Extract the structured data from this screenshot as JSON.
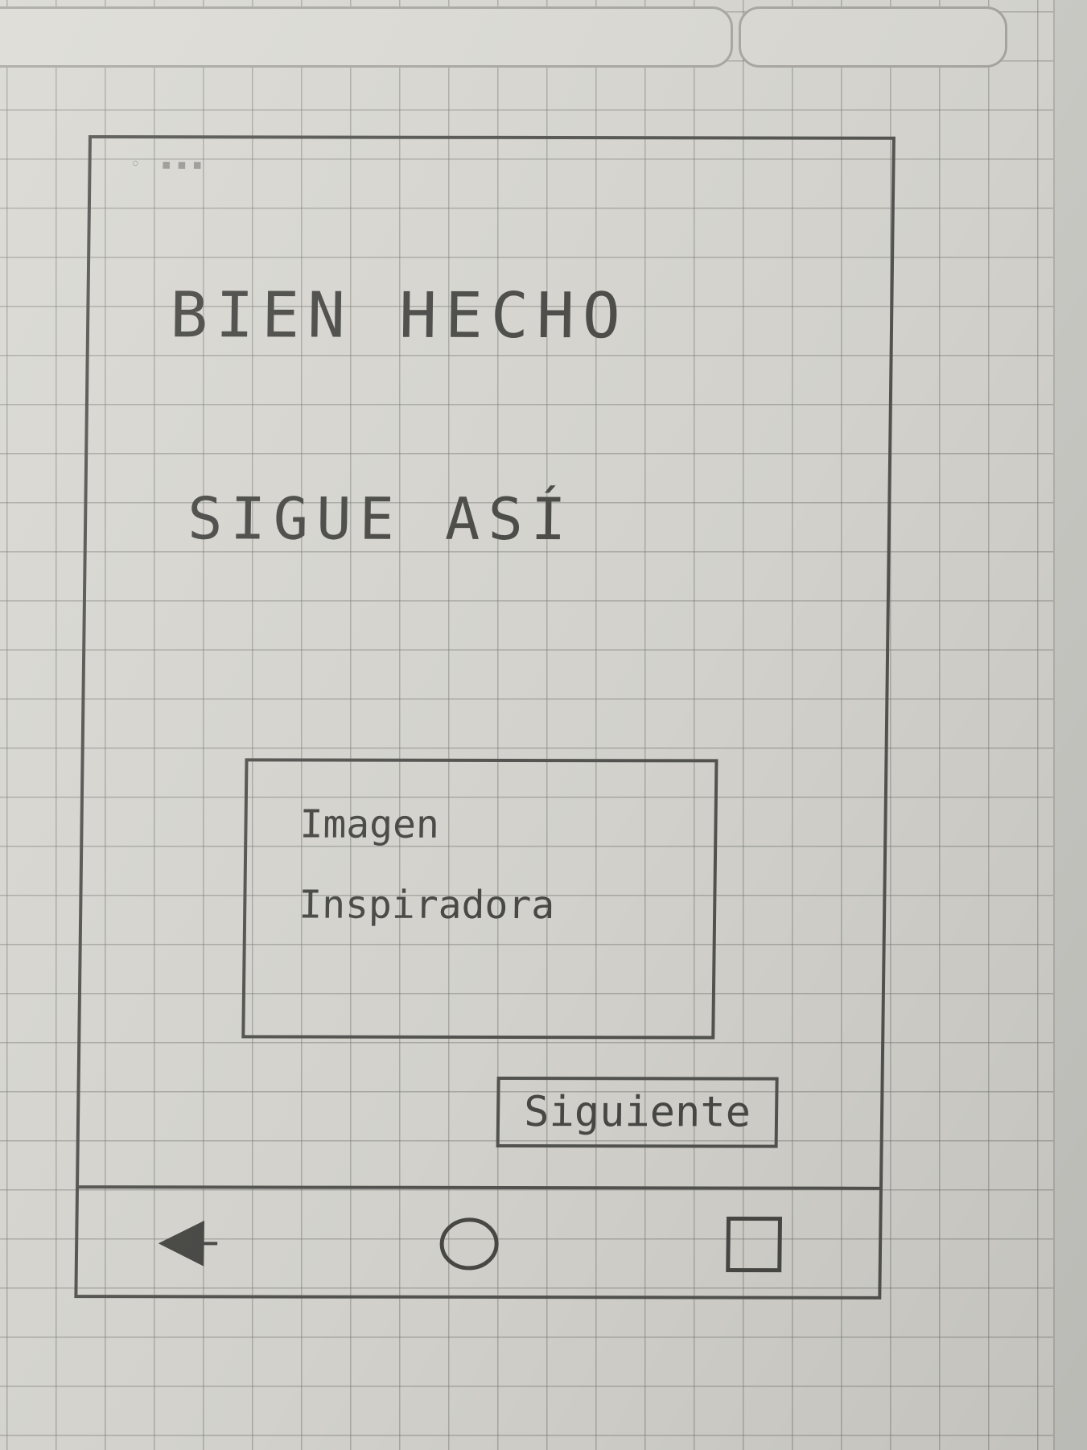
{
  "screen": {
    "heading": "BIEN HECHO",
    "subheading": "SIGUE ASÍ"
  },
  "image_placeholder": {
    "caption": "Imagen Inspiradora"
  },
  "actions": {
    "next_label": "Siguiente"
  },
  "nav_bar": {
    "back_icon": "back-triangle-icon",
    "home_icon": "home-circle-icon",
    "recent_icon": "recent-apps-square-icon"
  },
  "colors": {
    "paper": "#d9d8d2",
    "pencil": "#555552"
  }
}
